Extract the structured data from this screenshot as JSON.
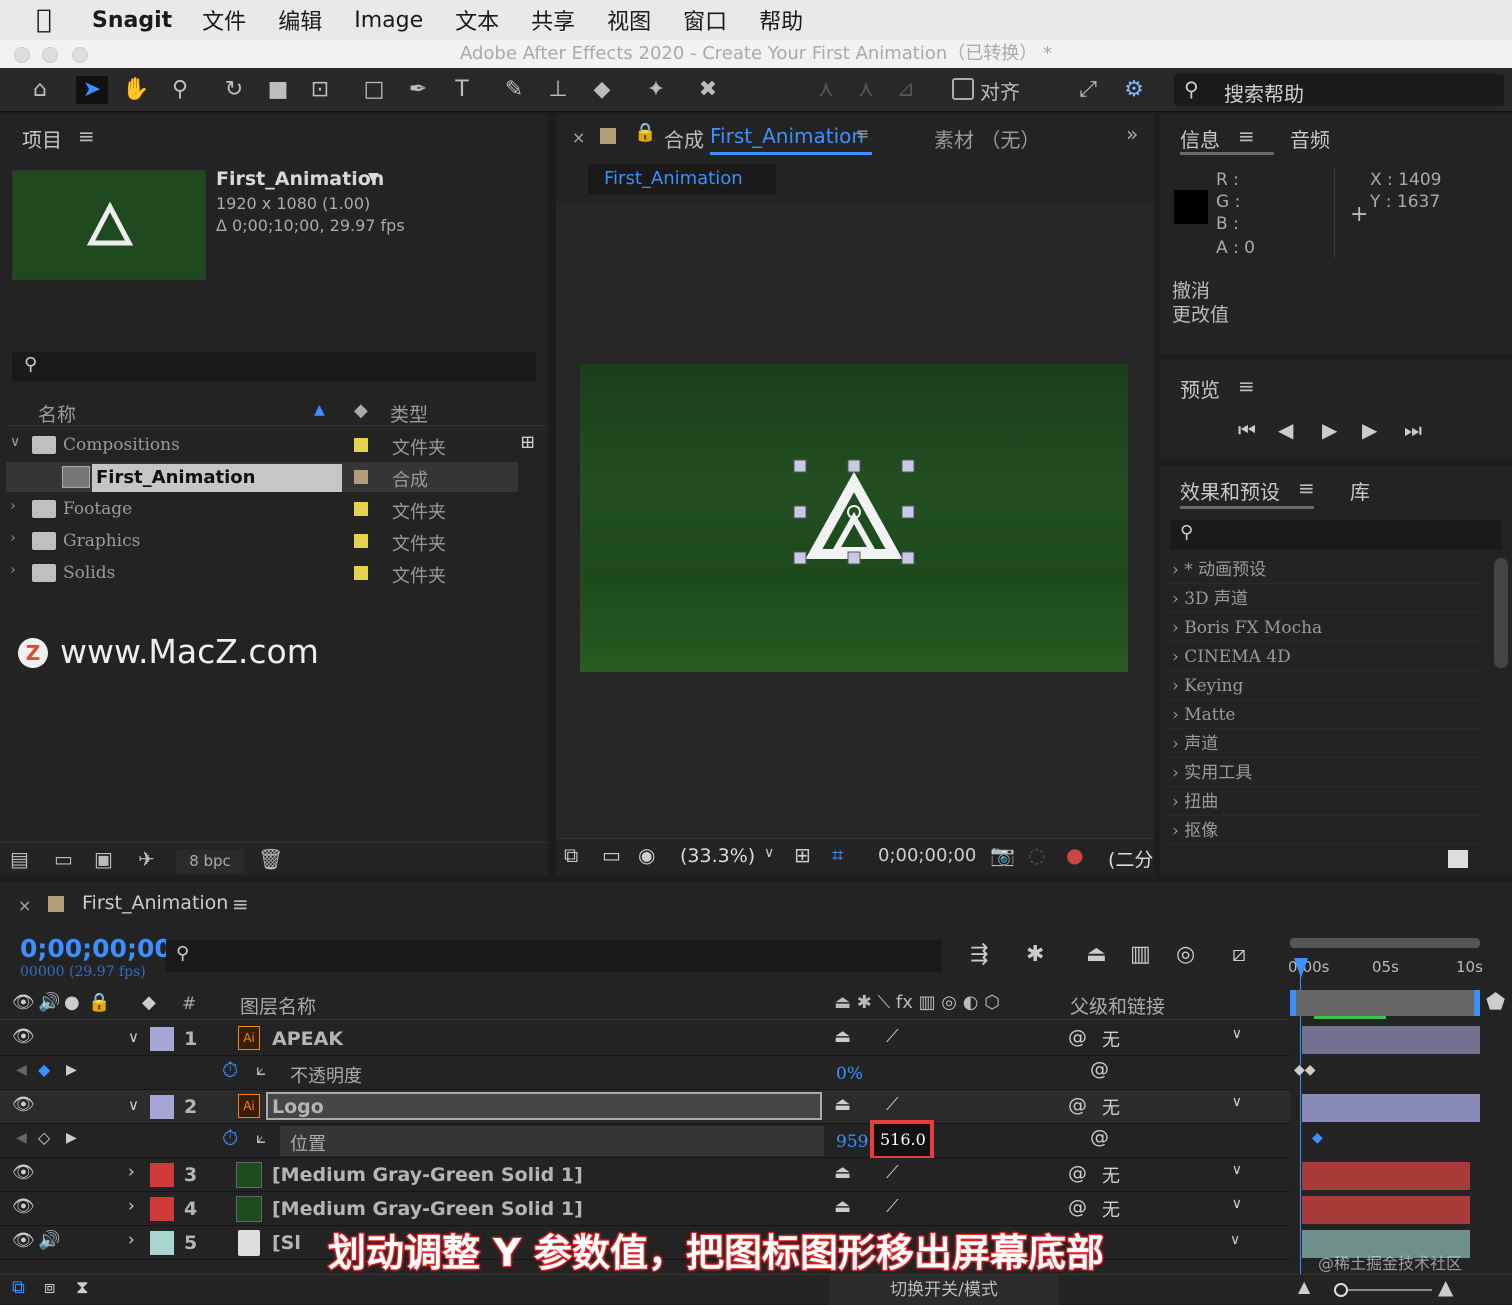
{
  "menubar": {
    "app": "Snagit",
    "items": [
      "文件",
      "编辑",
      "Image",
      "文本",
      "共享",
      "视图",
      "窗口",
      "帮助"
    ]
  },
  "window_title": "Adobe After Effects 2020 - Create Your First Animation（已转换） *",
  "toolbar": {
    "align_label": "对齐",
    "search_help": "搜索帮助"
  },
  "project": {
    "title": "项目",
    "comp_name": "First_Animation",
    "resolution": "1920 x 1080 (1.00)",
    "duration": "Δ 0;00;10;00, 29.97 fps",
    "col_name": "名称",
    "col_type": "类型",
    "bpc": "8 bpc",
    "items": [
      {
        "name": "Compositions",
        "type": "文件夹",
        "color": "#e6d34a"
      },
      {
        "name": "First_Animation",
        "type": "合成",
        "color": "#b19e78"
      },
      {
        "name": "Footage",
        "type": "文件夹",
        "color": "#e6d34a"
      },
      {
        "name": "Graphics",
        "type": "文件夹",
        "color": "#e6d34a"
      },
      {
        "name": "Solids",
        "type": "文件夹",
        "color": "#e6d34a"
      }
    ]
  },
  "watermark": "www.MacZ.com",
  "comp_panel": {
    "title_prefix": "合成",
    "title": "First_Animation",
    "footage": "素材 （无）",
    "tab": "First_Animation",
    "zoom": "(33.3%)",
    "timecode": "0;00;00;00",
    "quality": "(二分"
  },
  "info": {
    "title": "信息",
    "audio": "音频",
    "r": "R :",
    "g": "G :",
    "b": "B :",
    "a": "A :  0",
    "x": "X : 1409",
    "y": "Y :  1637",
    "undo1": "撤消",
    "undo2": "更改值"
  },
  "preview": {
    "title": "预览"
  },
  "effects": {
    "title": "效果和预设",
    "library": "库",
    "items": [
      "* 动画预设",
      "3D 声道",
      "Boris FX Mocha",
      "CINEMA 4D",
      "Keying",
      "Matte",
      "声道",
      "实用工具",
      "扭曲",
      "抠像"
    ]
  },
  "timeline": {
    "tab": "First_Animation",
    "timecode": "0;00;00;00",
    "frames": "00000 (29.97 fps)",
    "col_num": "#",
    "col_name": "图层名称",
    "col_parent": "父级和链接",
    "ruler": [
      "0:00s",
      "05s",
      "10s"
    ],
    "toggle_modes": "切换开关/模式",
    "layers": [
      {
        "num": "1",
        "name": "APEAK",
        "color": "#a6a6d6",
        "parent": "无"
      },
      {
        "num": "2",
        "name": "Logo",
        "color": "#a6a6d6",
        "parent": "无"
      },
      {
        "num": "3",
        "name": "[Medium Gray-Green Solid 1]",
        "color": "#cf3b3b",
        "parent": "无"
      },
      {
        "num": "4",
        "name": "[Medium Gray-Green Solid 1]",
        "color": "#cf3b3b",
        "parent": "无"
      },
      {
        "num": "5",
        "name": "[Sl",
        "color": "#a8d6cf",
        "parent": ""
      }
    ],
    "opacity_label": "不透明度",
    "opacity_value": "0%",
    "position_label": "位置",
    "position_x": "959.",
    "position_y": "516.0"
  },
  "caption": "划动调整 Y 参数值，把图标图形移出屏幕底部",
  "credit": "@稀土掘金技术社区"
}
